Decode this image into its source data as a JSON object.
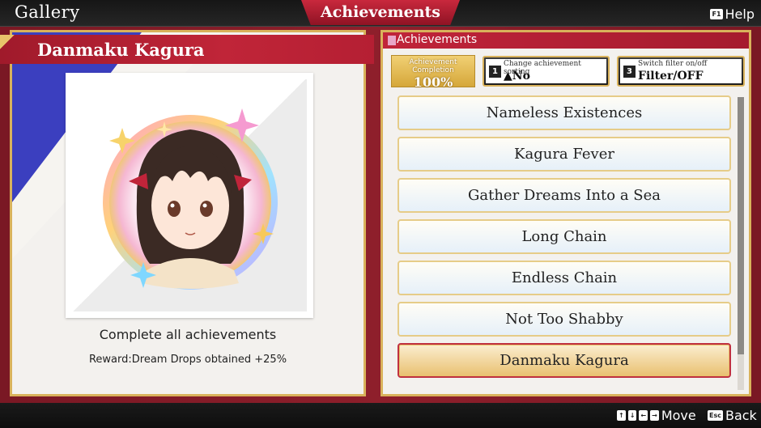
{
  "topbar": {
    "gallery_title": "Gallery",
    "tab_title": "Achievements",
    "help_key": "F1",
    "help_label": "Help"
  },
  "left": {
    "achievement_title": "Danmaku Kagura",
    "description": "Complete all achievements",
    "reward": "Reward:Dream Drops obtained +25%"
  },
  "right": {
    "header": "Achievements",
    "completion_label": "Achievement Completion",
    "completion_value": "100%",
    "sort_button": {
      "key": "1",
      "label": "Change achievement sorting",
      "value": "▲No"
    },
    "filter_button": {
      "key": "3",
      "label": "Switch filter on/off",
      "value": "Filter/OFF"
    },
    "items": [
      {
        "label": "Nameless Existences",
        "selected": false
      },
      {
        "label": "Kagura Fever",
        "selected": false
      },
      {
        "label": "Gather Dreams Into a Sea",
        "selected": false
      },
      {
        "label": "Long Chain",
        "selected": false
      },
      {
        "label": "Endless Chain",
        "selected": false
      },
      {
        "label": "Not Too Shabby",
        "selected": false
      },
      {
        "label": "Danmaku Kagura",
        "selected": true
      }
    ]
  },
  "bottombar": {
    "move_keys": [
      "↑",
      "↓",
      "←",
      "→"
    ],
    "move_label": "Move",
    "back_key": "Esc",
    "back_label": "Back"
  },
  "colors": {
    "accent_red": "#b51f33",
    "gold_border": "#d9b25b",
    "panel_bg": "#f3f1ee"
  }
}
